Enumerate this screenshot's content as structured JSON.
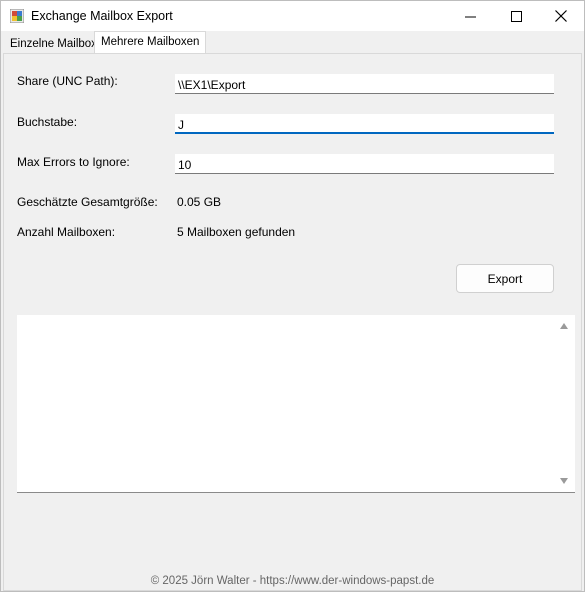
{
  "window": {
    "title": "Exchange Mailbox Export"
  },
  "tabs": [
    {
      "label": "Einzelne Mailbox",
      "active": false
    },
    {
      "label": "Mehrere Mailboxen",
      "active": true
    }
  ],
  "form": {
    "share_label": "Share (UNC Path):",
    "share_value": "\\\\EX1\\Export",
    "letter_label": "Buchstabe:",
    "letter_value": "J",
    "max_errors_label": "Max Errors to Ignore:",
    "max_errors_value": "10",
    "size_label": "Geschätzte Gesamtgröße:",
    "size_value": "0.05 GB",
    "count_label": "Anzahl Mailboxen:",
    "count_value": "5 Mailboxen gefunden"
  },
  "actions": {
    "export_label": "Export"
  },
  "log": {
    "text": ""
  },
  "footer": {
    "text": "© 2025 Jörn Walter - https://www.der-windows-papst.de"
  },
  "colors": {
    "accent": "#0067c0",
    "window_bg": "#f0f0f0"
  }
}
